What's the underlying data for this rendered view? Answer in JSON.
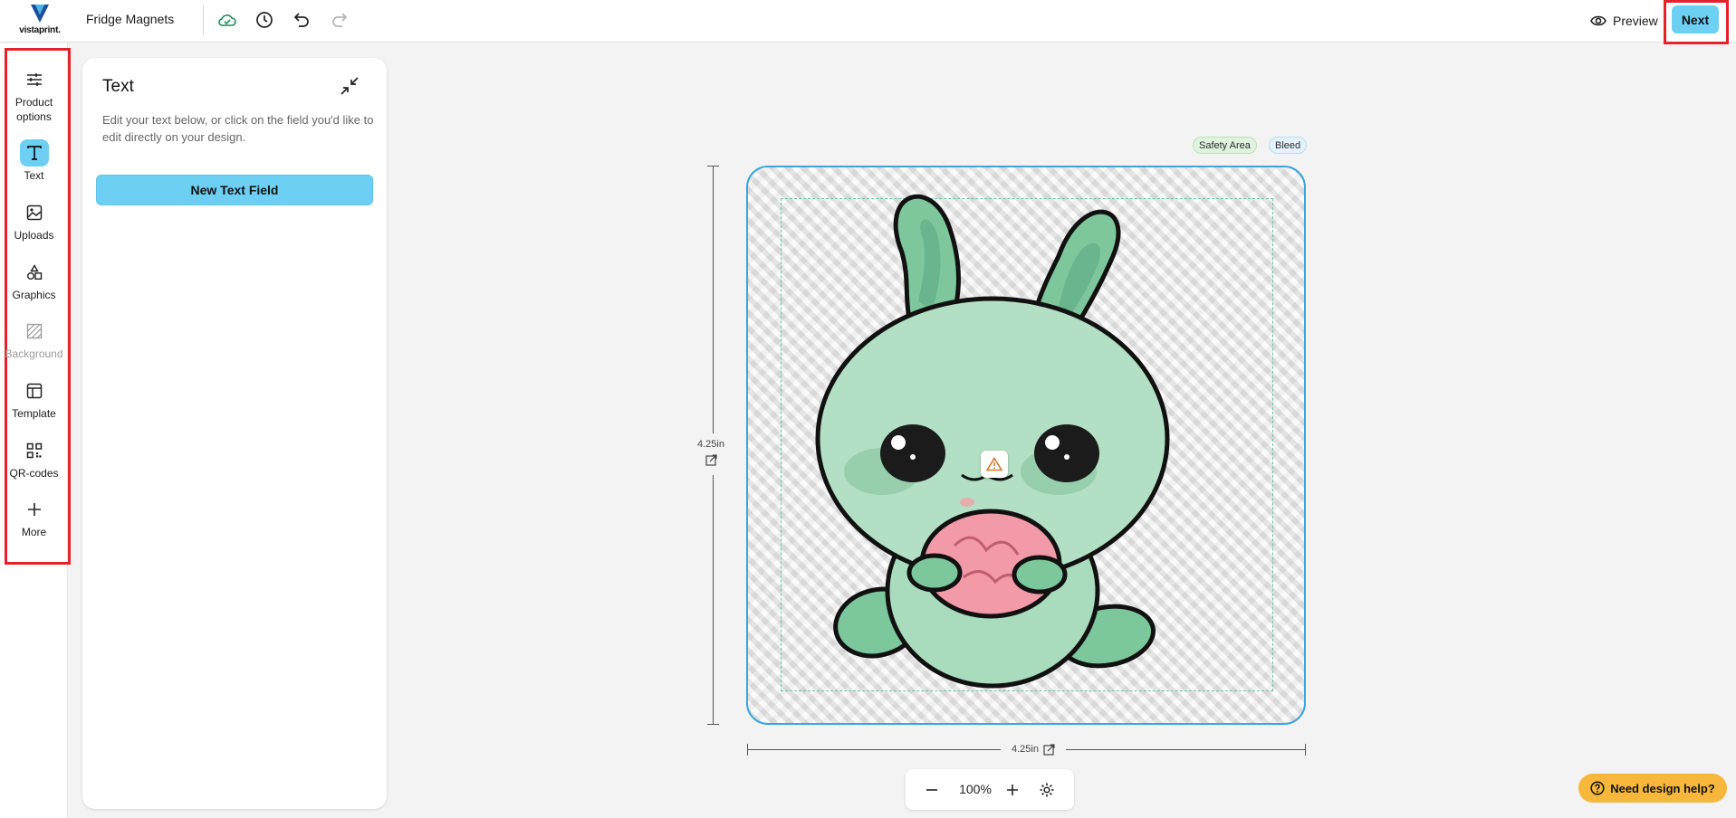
{
  "app": {
    "logo_text": "vistaprint.",
    "document_title": "Fridge Magnets",
    "preview_label": "Preview",
    "next_label": "Next"
  },
  "toolbar_icons": [
    "cloud-saved-icon",
    "history-icon",
    "undo-icon",
    "redo-icon"
  ],
  "sidebar": {
    "items": [
      {
        "id": "product-options",
        "line1": "Product",
        "line2": "options",
        "icon": "sliders-icon",
        "active": false,
        "disabled": false
      },
      {
        "id": "text",
        "line1": "Text",
        "line2": "",
        "icon": "text-icon",
        "active": true,
        "disabled": false
      },
      {
        "id": "uploads",
        "line1": "Uploads",
        "line2": "",
        "icon": "image-icon",
        "active": false,
        "disabled": false
      },
      {
        "id": "graphics",
        "line1": "Graphics",
        "line2": "",
        "icon": "shapes-icon",
        "active": false,
        "disabled": false
      },
      {
        "id": "background",
        "line1": "Background",
        "line2": "",
        "icon": "hatch-icon",
        "active": false,
        "disabled": true
      },
      {
        "id": "template",
        "line1": "Template",
        "line2": "",
        "icon": "layout-icon",
        "active": false,
        "disabled": false
      },
      {
        "id": "qr-codes",
        "line1": "QR-codes",
        "line2": "",
        "icon": "qr-icon",
        "active": false,
        "disabled": false
      },
      {
        "id": "more",
        "line1": "More",
        "line2": "",
        "icon": "plus-icon",
        "active": false,
        "disabled": false
      }
    ]
  },
  "panel": {
    "title": "Text",
    "description": "Edit your text below, or click on the field you'd like to edit directly on your design.",
    "new_field_button": "New Text Field"
  },
  "canvas": {
    "safety_area_label": "Safety Area",
    "bleed_label": "Bleed",
    "height_label": "4.25in",
    "width_label": "4.25in",
    "zoom": "100%"
  },
  "help": {
    "label": "Need design help?"
  },
  "colors": {
    "accent": "#6dd0f3",
    "highlight_frame": "#e3222c",
    "design_border": "#3aa6dd",
    "help_button": "#f6b73c"
  }
}
